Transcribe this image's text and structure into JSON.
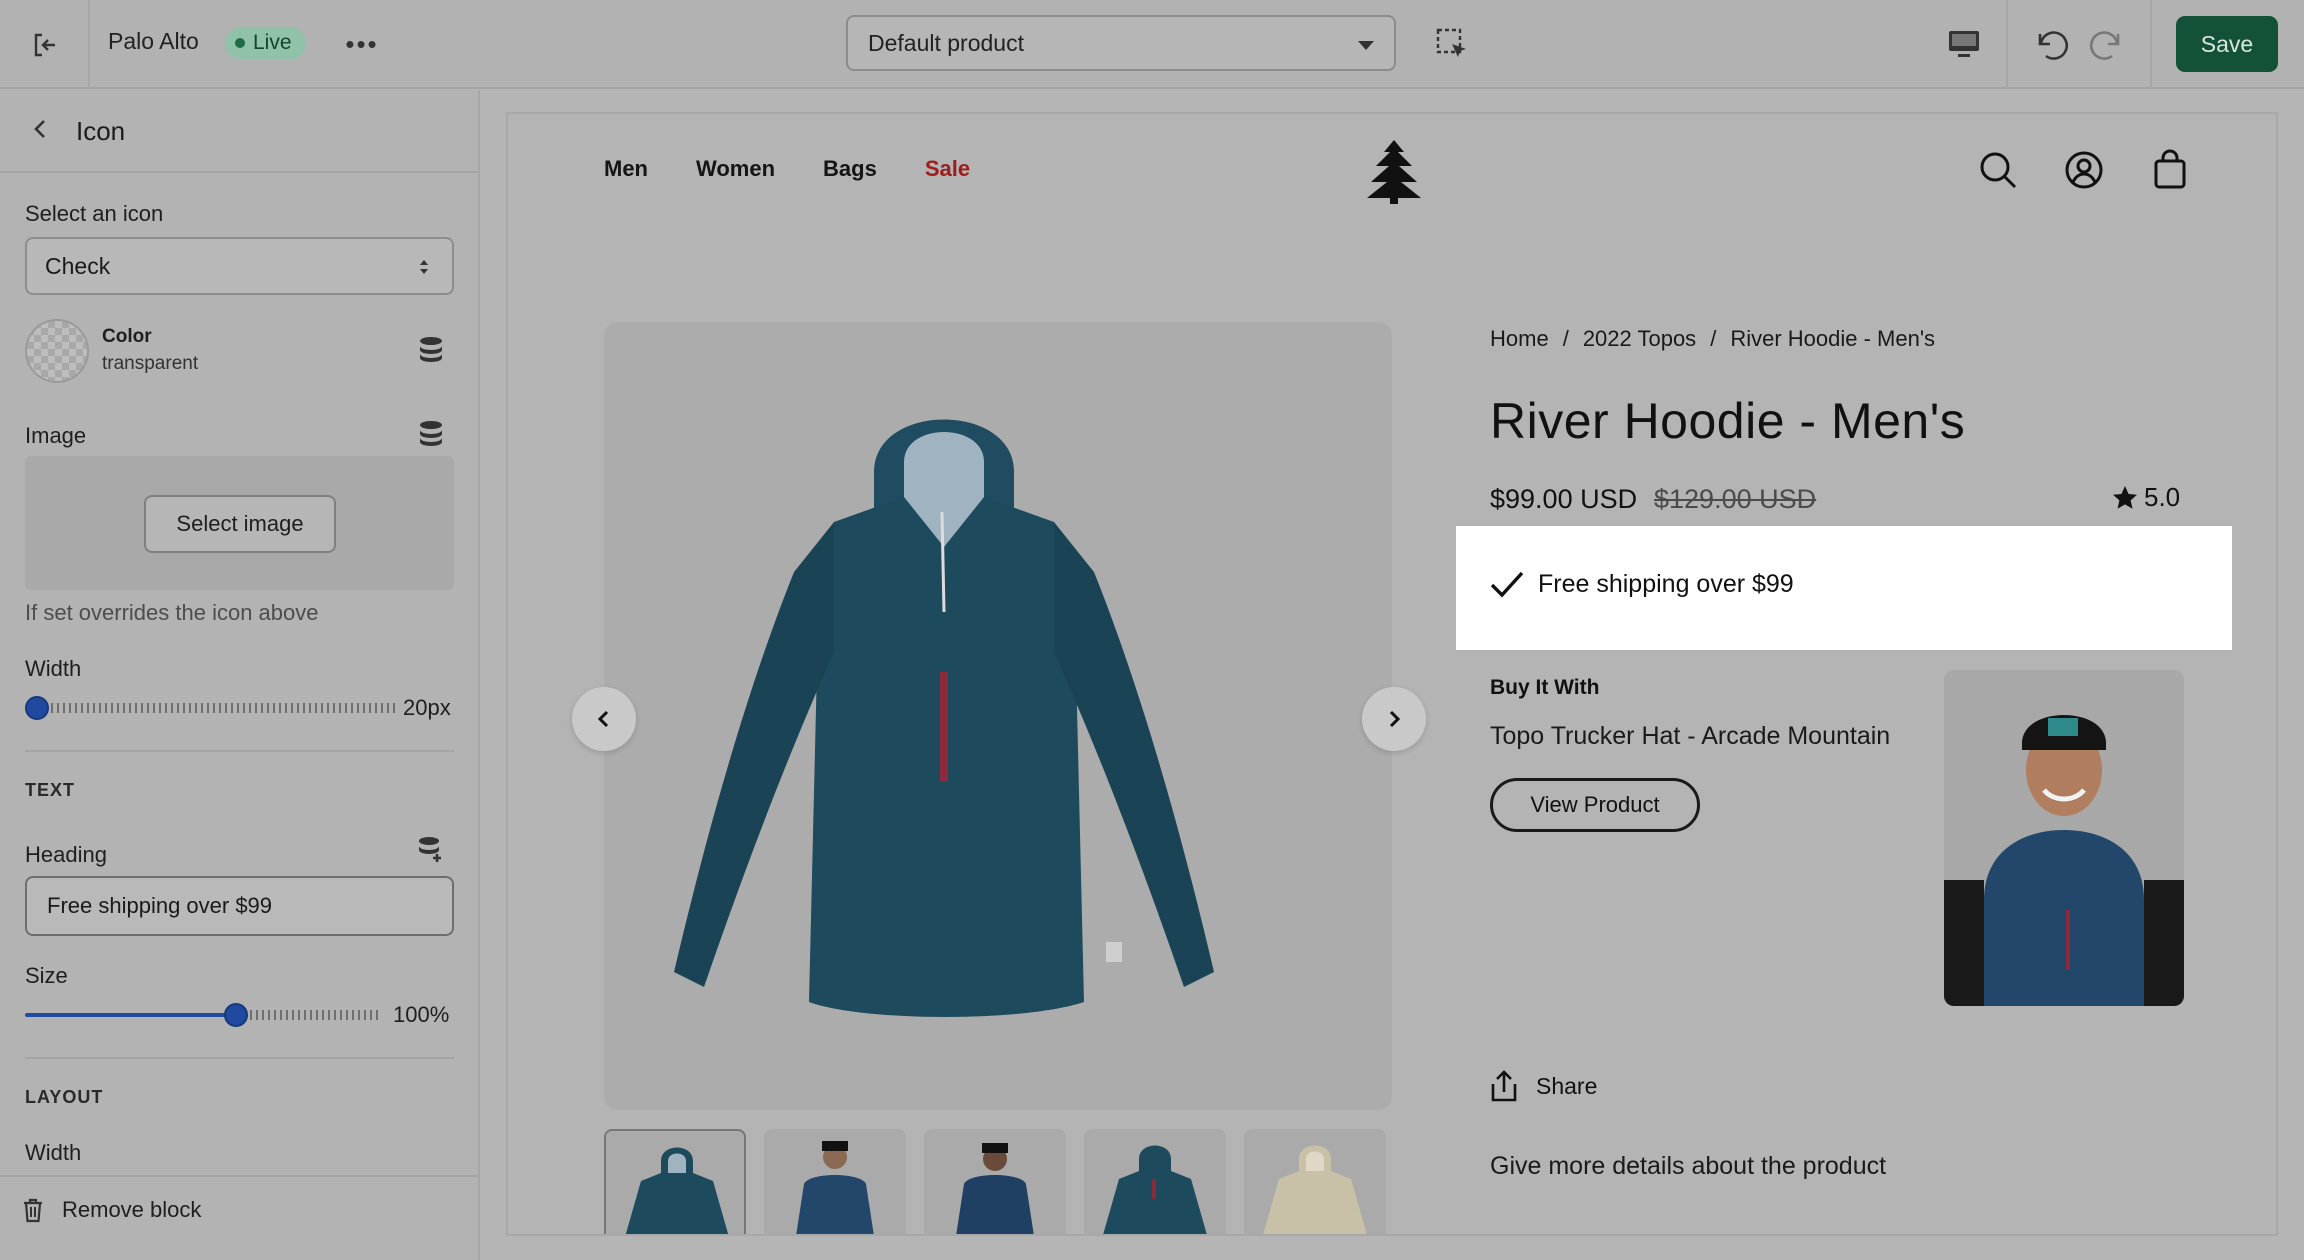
{
  "topbar": {
    "store_name": "Palo Alto",
    "live_label": "Live",
    "more_label": "•••",
    "template_value": "Default product",
    "save_label": "Save"
  },
  "sidebar": {
    "title": "Icon",
    "select_icon_label": "Select an icon",
    "select_icon_value": "Check",
    "color_label": "Color",
    "color_value": "transparent",
    "image_label": "Image",
    "select_image_label": "Select image",
    "image_help": "If set overrides the icon above",
    "width_label": "Width",
    "width_value": "20px",
    "text_section": "TEXT",
    "heading_label": "Heading",
    "heading_value": "Free shipping over $99",
    "size_label": "Size",
    "size_value": "100%",
    "size_fraction": 0.6,
    "layout_section": "LAYOUT",
    "layout_width_label": "Width",
    "remove_label": "Remove block"
  },
  "preview": {
    "nav": [
      "Men",
      "Women",
      "Bags",
      "Sale"
    ],
    "breadcrumb": [
      "Home",
      "/",
      "2022 Topos",
      "/",
      "River Hoodie - Men's"
    ],
    "product_title": "River Hoodie - Men's",
    "price": "$99.00 USD",
    "compare_price": "$129.00 USD",
    "rating": "5.0",
    "shipping_text": "Free shipping over $99",
    "buy_with_heading": "Buy It With",
    "related_product": "Topo Trucker Hat - Arcade Mountain",
    "view_product_label": "View Product",
    "share_label": "Share",
    "details_text": "Give more details about the product"
  },
  "colors": {
    "save_bg": "#145237",
    "slider_accent": "#1f4aa0",
    "sale_red": "#a01c1c",
    "hoodie": "#1e4a5e"
  },
  "icons": [
    "exit-icon",
    "more-icon",
    "chevron-down-icon",
    "inspect-icon",
    "desktop-icon",
    "undo-icon",
    "redo-icon",
    "chevron-left-icon",
    "updown-icon",
    "database-icon",
    "trash-icon",
    "tree-logo-icon",
    "search-icon",
    "account-icon",
    "bag-icon",
    "check-icon",
    "star-icon",
    "share-icon",
    "arrow-left-icon",
    "arrow-right-icon"
  ]
}
